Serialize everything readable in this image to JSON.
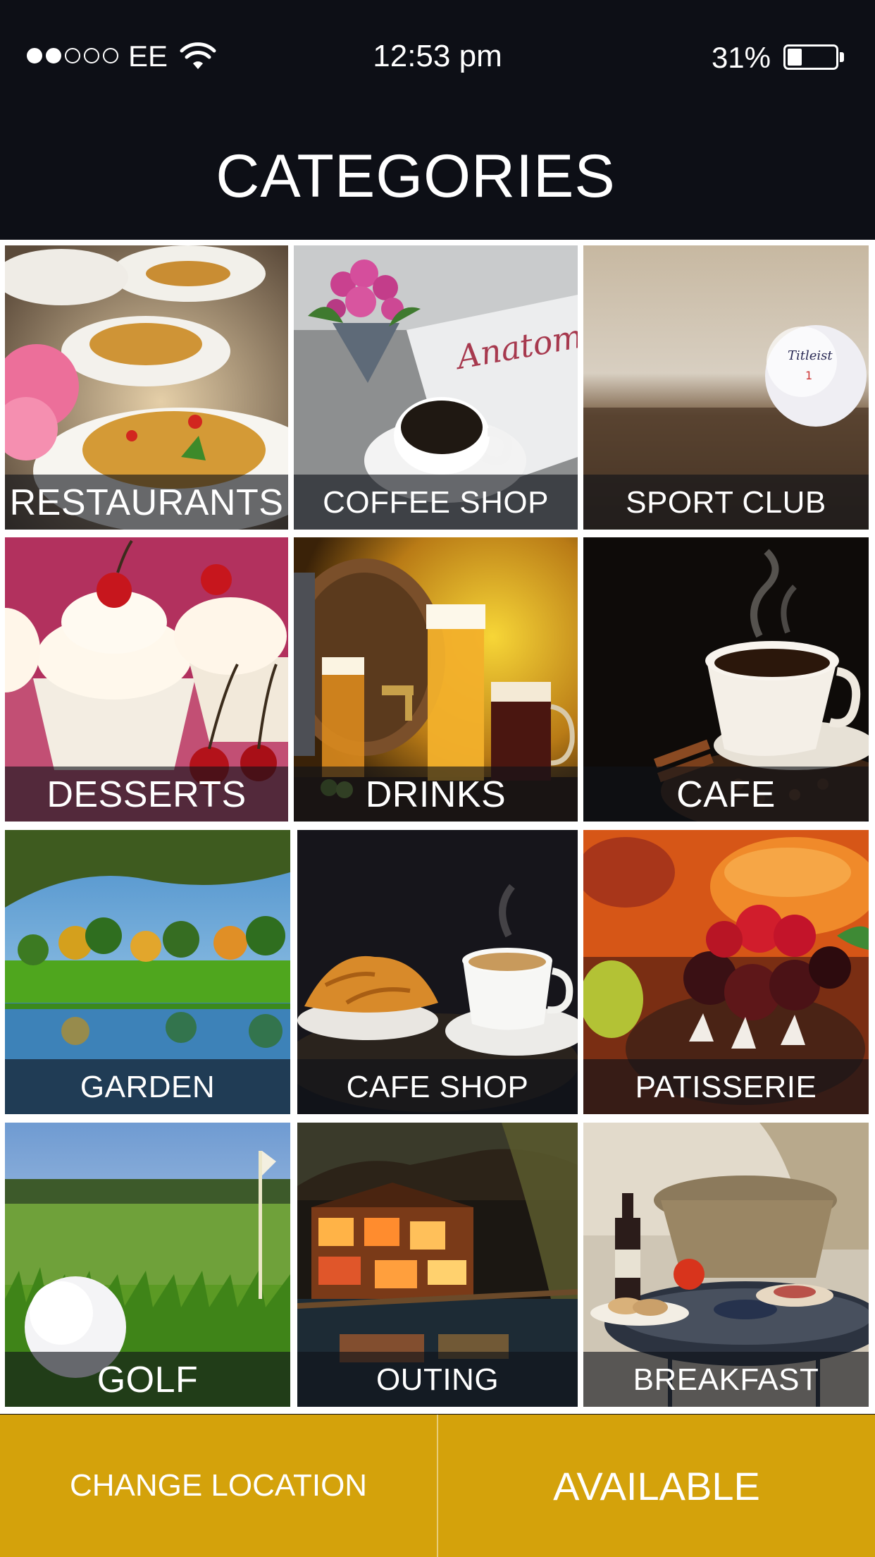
{
  "status_bar": {
    "carrier": "EE",
    "time": "12:53 pm",
    "battery_percent": "31%",
    "battery_level": 0.31,
    "signal_bars_filled": 2,
    "signal_bars_total": 5
  },
  "header": {
    "title": "CATEGORIES"
  },
  "categories": [
    {
      "label": "RESTAURANTS",
      "icon": "pasta-photo"
    },
    {
      "label": "COFFEE SHOP",
      "icon": "coffee-cup-photo"
    },
    {
      "label": "SPORT CLUB",
      "icon": "golf-ball-photo"
    },
    {
      "label": "DESSERTS",
      "icon": "cupcake-photo"
    },
    {
      "label": "DRINKS",
      "icon": "beer-barrel-photo"
    },
    {
      "label": "CAFE",
      "icon": "steaming-cup-photo"
    },
    {
      "label": "GARDEN",
      "icon": "park-lake-photo"
    },
    {
      "label": "CAFE SHOP",
      "icon": "croissant-coffee-photo"
    },
    {
      "label": "PATISSERIE",
      "icon": "fruit-tart-photo"
    },
    {
      "label": "GOLF",
      "icon": "golf-green-photo"
    },
    {
      "label": "OUTING",
      "icon": "night-town-photo"
    },
    {
      "label": "BREAKFAST",
      "icon": "breakfast-table-photo"
    }
  ],
  "bottom_bar": {
    "change_location_label": "CHANGE LOCATION",
    "available_label": "AVAILABLE"
  },
  "colors": {
    "background": "#0d0f16",
    "accent": "#d4a20b",
    "text": "#ffffff"
  }
}
